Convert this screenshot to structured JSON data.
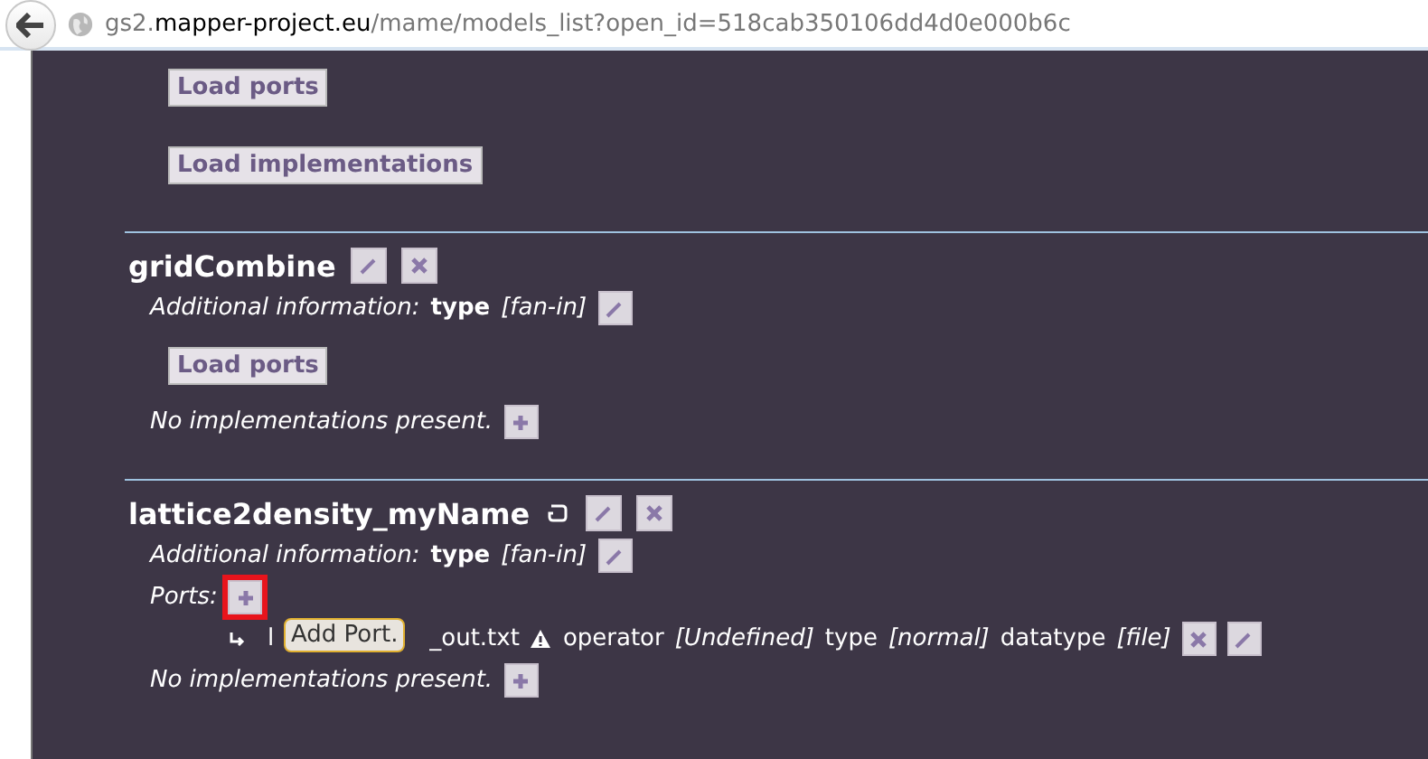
{
  "address_bar": {
    "host_prefix": "gs2.",
    "host": "mapper-project.eu",
    "path": "/mame/models_list?open_id=518cab350106dd4d0e000b6c"
  },
  "top_buttons": [
    "Load ports",
    "Load implementations"
  ],
  "models": [
    {
      "name": "gridCombine",
      "status_icon": false,
      "rows": [
        {
          "kind": "info",
          "label": "Additional information:",
          "key": "type",
          "value": "[fan-in]"
        },
        {
          "kind": "button",
          "label": "Load ports"
        },
        {
          "kind": "add",
          "text": "No implementations present."
        }
      ]
    },
    {
      "name": "lattice2density_myName",
      "status_icon": true,
      "rows": [
        {
          "kind": "info",
          "label": "Additional information:",
          "key": "type",
          "value": "[fan-in]"
        },
        {
          "kind": "ports",
          "label": "Ports:",
          "highlighted": true,
          "tooltip": "Add Port.",
          "ports": [
            {
              "name_start": "l",
              "name_end": "_out.txt",
              "warning": true,
              "fields": [
                {
                  "key": "operator",
                  "value": "[Undefined]"
                },
                {
                  "key": "type",
                  "value": "[normal]"
                },
                {
                  "key": "datatype",
                  "value": "[file]"
                }
              ]
            }
          ]
        },
        {
          "kind": "add",
          "text": "No implementations present."
        }
      ]
    }
  ]
}
